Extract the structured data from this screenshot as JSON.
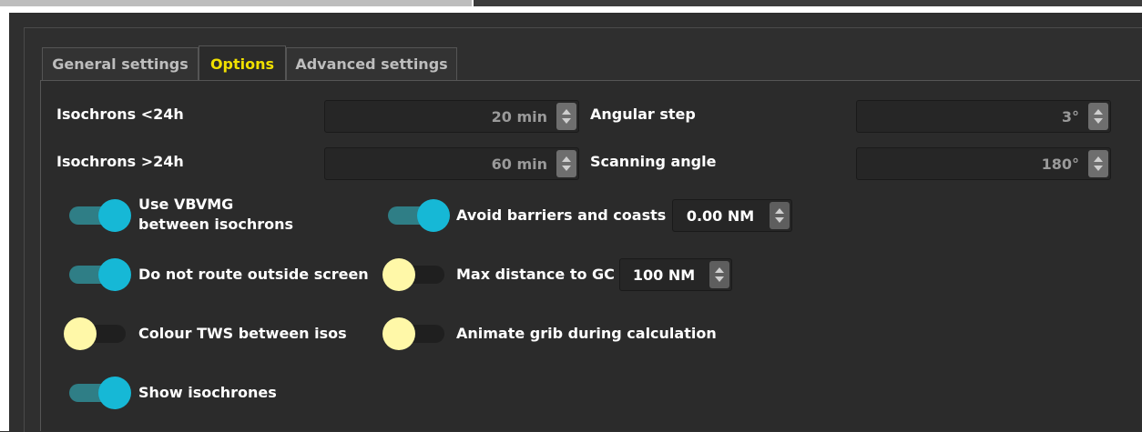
{
  "tabs": [
    {
      "label": "General settings",
      "active": false
    },
    {
      "label": "Options",
      "active": true
    },
    {
      "label": "Advanced settings",
      "active": false
    }
  ],
  "fields": {
    "isochrons_lt24": {
      "label": "Isochrons <24h",
      "value": "20 min"
    },
    "isochrons_gt24": {
      "label": "Isochrons >24h",
      "value": "60 min"
    },
    "angular_step": {
      "label": "Angular step",
      "value": "3°"
    },
    "scanning_angle": {
      "label": "Scanning angle",
      "value": "180°"
    }
  },
  "toggles": {
    "use_vbvmg": {
      "label_line1": "Use VBVMG",
      "label_line2": "between isochrons",
      "on": true
    },
    "avoid_barriers": {
      "label": "Avoid barriers and coasts",
      "on": true,
      "value": "0.00 NM"
    },
    "do_not_route_outside": {
      "label": "Do not route outside screen",
      "on": true
    },
    "max_distance_gc": {
      "label": "Max distance to GC",
      "on": false,
      "value": "100 NM"
    },
    "colour_tws": {
      "label": "Colour TWS between isos",
      "on": false
    },
    "animate_grib": {
      "label": "Animate grib during calculation",
      "on": false
    },
    "show_isochrones": {
      "label": "Show isochrones",
      "on": true
    }
  },
  "colors": {
    "active_tab_text": "#f0e000",
    "toggle_on_knob": "#16b8d6",
    "toggle_off_knob": "#fff8a8"
  }
}
